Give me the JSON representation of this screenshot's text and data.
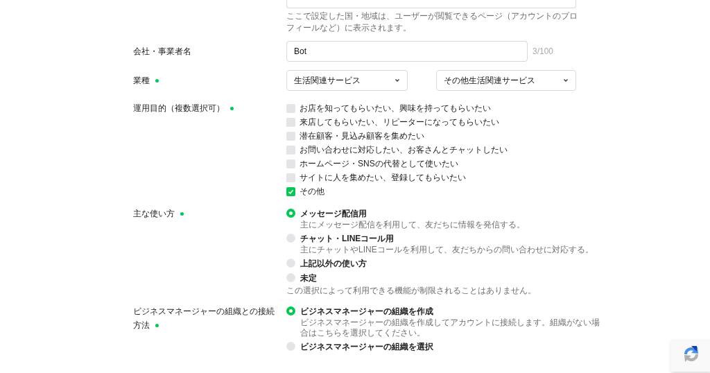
{
  "location_field": {
    "help": "ここで設定した国・地域は、ユーザーが閲覧できるページ（アカウントのプロフィールなど）に表示されます。"
  },
  "company_name": {
    "label": "会社・事業者名",
    "value": "Bot",
    "counter": "3/100"
  },
  "industry": {
    "label": "業種",
    "required": true,
    "selects": [
      "生活関連サービス",
      "その他生活関連サービス"
    ]
  },
  "purposes": {
    "label": "運用目的（複数選択可）",
    "required": true,
    "options": [
      {
        "label": "お店を知ってもらいたい、興味を持ってもらいたい",
        "checked": false
      },
      {
        "label": "来店してもらいたい、リピーターになってもらいたい",
        "checked": false
      },
      {
        "label": "潜在顧客・見込み顧客を集めたい",
        "checked": false
      },
      {
        "label": "お問い合わせに対応したい、お客さんとチャットしたい",
        "checked": false
      },
      {
        "label": "ホームページ・SNSの代替として使いたい",
        "checked": false
      },
      {
        "label": "サイトに人を集めたい、登録してもらいたい",
        "checked": false
      },
      {
        "label": "その他",
        "checked": true
      }
    ]
  },
  "usage": {
    "label": "主な使い方",
    "required": true,
    "options": [
      {
        "label": "メッセージ配信用",
        "description": "主にメッセージ配信を利用して、友だちに情報を発信する。",
        "selected": true
      },
      {
        "label": "チャット・LINEコール用",
        "description": "主にチャットやLINEコールを利用して、友だちからの問い合わせに対応する。",
        "selected": false
      },
      {
        "label": "上記以外の使い方",
        "selected": false
      },
      {
        "label": "未定",
        "selected": false
      }
    ],
    "note": "この選択によって利用できる機能が制限されることはありません。"
  },
  "bm_connection": {
    "label": "ビジネスマネージャーの組織との接続方法",
    "required": true,
    "options": [
      {
        "label": "ビジネスマネージャーの組織を作成",
        "description": "ビジネスマネージャーの組織を作成してアカウントに接続します。組織がない場合はこちらを選択してください。",
        "selected": true
      },
      {
        "label": "ビジネスマネージャーの組織を選択",
        "selected": false
      }
    ]
  }
}
